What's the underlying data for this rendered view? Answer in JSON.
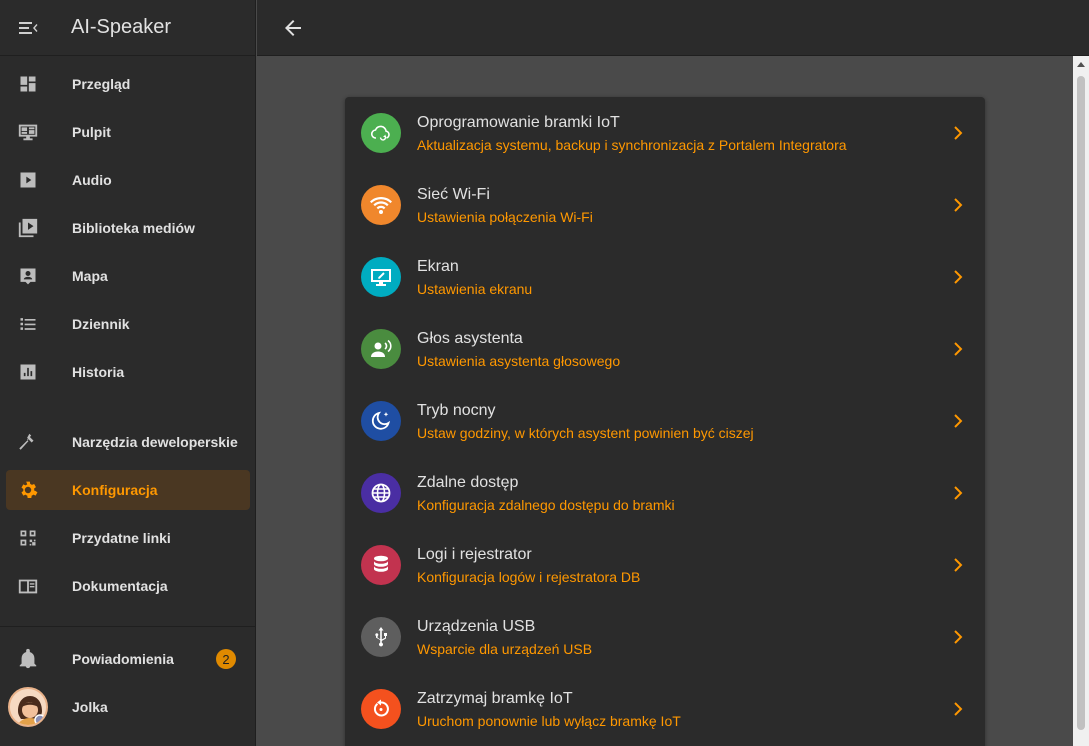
{
  "app": {
    "title": "AI-Speaker"
  },
  "sidebar": {
    "items": [
      {
        "label": "Przegląd",
        "icon": "dashboard-icon"
      },
      {
        "label": "Pulpit",
        "icon": "monitor-dashboard-icon"
      },
      {
        "label": "Audio",
        "icon": "play-box-icon"
      },
      {
        "label": "Biblioteka mediów",
        "icon": "play-box-multiple-icon"
      },
      {
        "label": "Mapa",
        "icon": "account-box-icon"
      },
      {
        "label": "Dziennik",
        "icon": "format-list-bulleted-icon"
      },
      {
        "label": "Historia",
        "icon": "chart-box-icon"
      }
    ],
    "tools": [
      {
        "label": "Narzędzia deweloperskie",
        "icon": "hammer-icon"
      },
      {
        "label": "Konfiguracja",
        "icon": "cog-icon"
      },
      {
        "label": "Przydatne linki",
        "icon": "qrcode-icon"
      },
      {
        "label": "Dokumentacja",
        "icon": "book-open-icon"
      }
    ],
    "notifications": {
      "label": "Powiadomienia",
      "count": "2"
    },
    "user": {
      "name": "Jolka"
    }
  },
  "colors": {
    "accent": "#ff9800",
    "sidebar_bg": "#2b2b2b",
    "main_bg": "#4a4a4a"
  },
  "settings": [
    {
      "title": "Oprogramowanie bramki IoT",
      "subtitle": "Aktualizacja systemu, backup i synchronizacja z Portalem Integratora",
      "icon": "cloud-sync-icon",
      "color": "#4caf50"
    },
    {
      "title": "Sieć Wi-Fi",
      "subtitle": "Ustawienia połączenia Wi-Fi",
      "icon": "wifi-icon",
      "color": "#f0872c"
    },
    {
      "title": "Ekran",
      "subtitle": "Ustawienia ekranu",
      "icon": "monitor-edit-icon",
      "color": "#00acc1"
    },
    {
      "title": "Głos asystenta",
      "subtitle": "Ustawienia asystenta głosowego",
      "icon": "account-voice-icon",
      "color": "#4a8c3f"
    },
    {
      "title": "Tryb nocny",
      "subtitle": "Ustaw godziny, w których asystent powinien być ciszej",
      "icon": "moon-star-icon",
      "color": "#1f4ea3"
    },
    {
      "title": "Zdalne dostęp",
      "subtitle": "Konfiguracja zdalnego dostępu do bramki",
      "icon": "web-icon",
      "color": "#4a2ea3"
    },
    {
      "title": "Logi i rejestrator",
      "subtitle": "Konfiguracja logów i rejestratora DB",
      "icon": "database-icon",
      "color": "#c2334f"
    },
    {
      "title": "Urządzenia USB",
      "subtitle": "Wsparcie dla urządzeń USB",
      "icon": "usb-icon",
      "color": "#5e5e5e"
    },
    {
      "title": "Zatrzymaj bramkę IoT",
      "subtitle": "Uruchom ponownie lub wyłącz bramkę IoT",
      "icon": "restart-icon",
      "color": "#f4511e"
    }
  ]
}
